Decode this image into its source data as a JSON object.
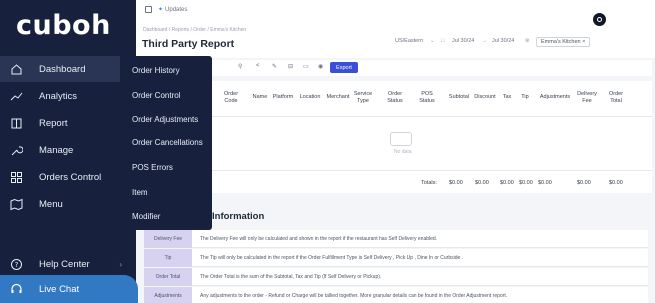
{
  "app": {
    "logo": "cuboh"
  },
  "sidebar": {
    "items": [
      {
        "label": "Dashboard",
        "icon": "home-icon"
      },
      {
        "label": "Analytics",
        "icon": "trend-icon"
      },
      {
        "label": "Report",
        "icon": "book-icon"
      },
      {
        "label": "Manage",
        "icon": "wrench-icon"
      },
      {
        "label": "Orders Control",
        "icon": "grid-icon"
      },
      {
        "label": "Menu",
        "icon": "map-icon"
      }
    ],
    "help": "Help Center",
    "live_chat": "Live Chat"
  },
  "submenu": {
    "items": [
      "Order History",
      "Order Control",
      "Order Adjustments",
      "Order Cancellations",
      "POS Errors",
      "Item",
      "Modifier"
    ]
  },
  "header": {
    "updates": "Updates",
    "breadcrumb": "Dashboard  /  Reports  /  Order  /  Emma's Kitchen",
    "title": "Third Party Report",
    "timezone": "US/Eastern",
    "date_from": "Jul 30/24",
    "date_to": "Jul 30/24",
    "store_chip": "Emma's Kitchen ×"
  },
  "toolbar": {
    "export": "Export"
  },
  "table": {
    "columns": [
      "Order Code",
      "Name",
      "Platform",
      "Location",
      "Merchant",
      "Service Type",
      "Order Status",
      "POS Status",
      "Subtotal",
      "Discount",
      "Tax",
      "Tip",
      "Adjustments",
      "Delivery Fee",
      "Order Total"
    ],
    "no_data": "No data",
    "totals_label": "Totals:",
    "totals": [
      "$0.00",
      "$0.00",
      "$0.00",
      "$0.00",
      "$0.00",
      "$0.00",
      "$0.00"
    ]
  },
  "info": {
    "title": "Information",
    "rows": [
      {
        "key": "Delivery Fee",
        "text": "The Delivery Fee will only be calculated and shown in the report if the restaurant has  Self Delivery  enabled."
      },
      {
        "key": "Tip",
        "text": "The Tip will only be calculated in the report if the Order Fulfillment Type is  Self Delivery ,  Pick Up ,  Dine In  or  Curbside ."
      },
      {
        "key": "Order Total",
        "text": "The Order Total is the sum of the Subtotal, Tax and Tip (If Self Delivery or Pickup)."
      },
      {
        "key": "Adjustments",
        "text": "Any adjustments to the order -  Refund  or  Charge  will be tallied together. More granular details can be found in the Order Adjustment report."
      }
    ]
  },
  "colors": {
    "sidebar": "#17213d",
    "accent": "#3279c4",
    "export": "#3b4fd6",
    "info_key": "#d7d2f0"
  }
}
